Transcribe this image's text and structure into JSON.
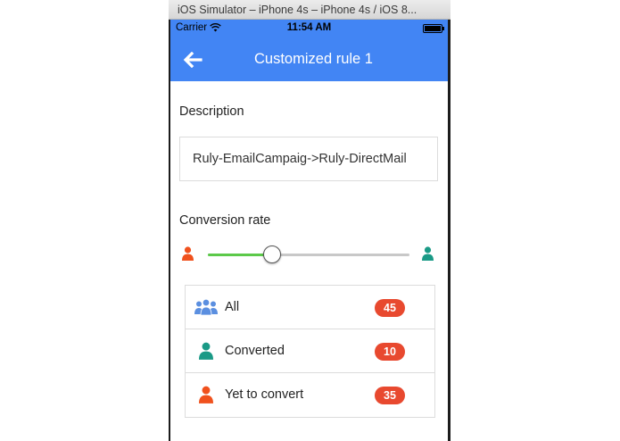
{
  "window": {
    "title": "iOS Simulator – iPhone 4s – iPhone 4s / iOS 8..."
  },
  "status_bar": {
    "carrier": "Carrier",
    "time": "11:54 AM"
  },
  "navbar": {
    "title": "Customized rule 1",
    "back_icon": "arrow-left-icon"
  },
  "description": {
    "label": "Description",
    "value": "Ruly-EmailCampaig->Ruly-DirectMail"
  },
  "conversion": {
    "label": "Conversion rate",
    "slider_value": 0.32,
    "left_icon": "person-orange-icon",
    "right_icon": "person-teal-icon"
  },
  "list": [
    {
      "label": "All",
      "count": "45",
      "icon": "group-icon"
    },
    {
      "label": "Converted",
      "count": "10",
      "icon": "person-teal-icon"
    },
    {
      "label": "Yet to convert",
      "count": "35",
      "icon": "person-orange-icon"
    }
  ],
  "colors": {
    "primary": "#4285f4",
    "badge": "#e8492f",
    "teal": "#1a9a86",
    "orange": "#f0511d",
    "slider_fill": "#5cc94a",
    "group_blue": "#5b8fe0"
  }
}
